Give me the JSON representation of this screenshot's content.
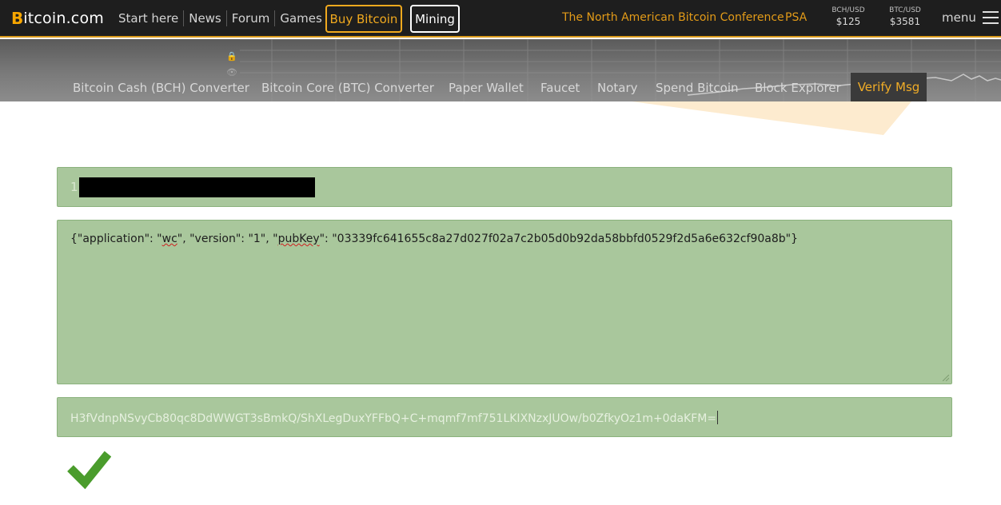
{
  "header": {
    "logo": {
      "b": "B",
      "rest": "itcoin.com"
    },
    "nav_links": [
      "Start here",
      "News",
      "Forum",
      "Games"
    ],
    "buy_button": "Buy Bitcoin",
    "mining_button": "Mining",
    "conference_link": "The North American Bitcoin Conference",
    "psa_link": "PSA",
    "prices": [
      {
        "label": "BCH/USD",
        "value": "$125"
      },
      {
        "label": "BTC/USD",
        "value": "$3581"
      }
    ],
    "menu_label": "menu"
  },
  "subnav": {
    "items": [
      "Bitcoin Cash (BCH) Converter",
      "Bitcoin Core (BTC) Converter",
      "Paper Wallet",
      "Faucet",
      "Notary",
      "Spend Bitcoin",
      "Block Explorer"
    ],
    "active_item": "Verify Msg"
  },
  "form": {
    "address_prefix": "1",
    "message": {
      "part1": "{\"application\": \"",
      "part2": "wc",
      "part3": "\", \"version\": \"1\", \"",
      "part4": "pubKey",
      "part5": "\": \"03339fc641655c8a27d027f02a7c2b05d0b92da58bbfd0529f2d5a6e632cf90a8b\"}"
    },
    "signature": "H3fVdnpNSvyCb80qc8DdWWGT3sBmkQ/ShXLegDuxYFFbQ+C+mqmf7mf751LKIXNzxJUOw/b0ZfkyOz1m+0daKFM="
  },
  "result": {
    "status": "verified"
  },
  "colors": {
    "brand_orange": "#f7a600",
    "field_green": "#a9c79c",
    "check_green": "#4a9c2c",
    "active_tab_text": "#f0ac27"
  }
}
